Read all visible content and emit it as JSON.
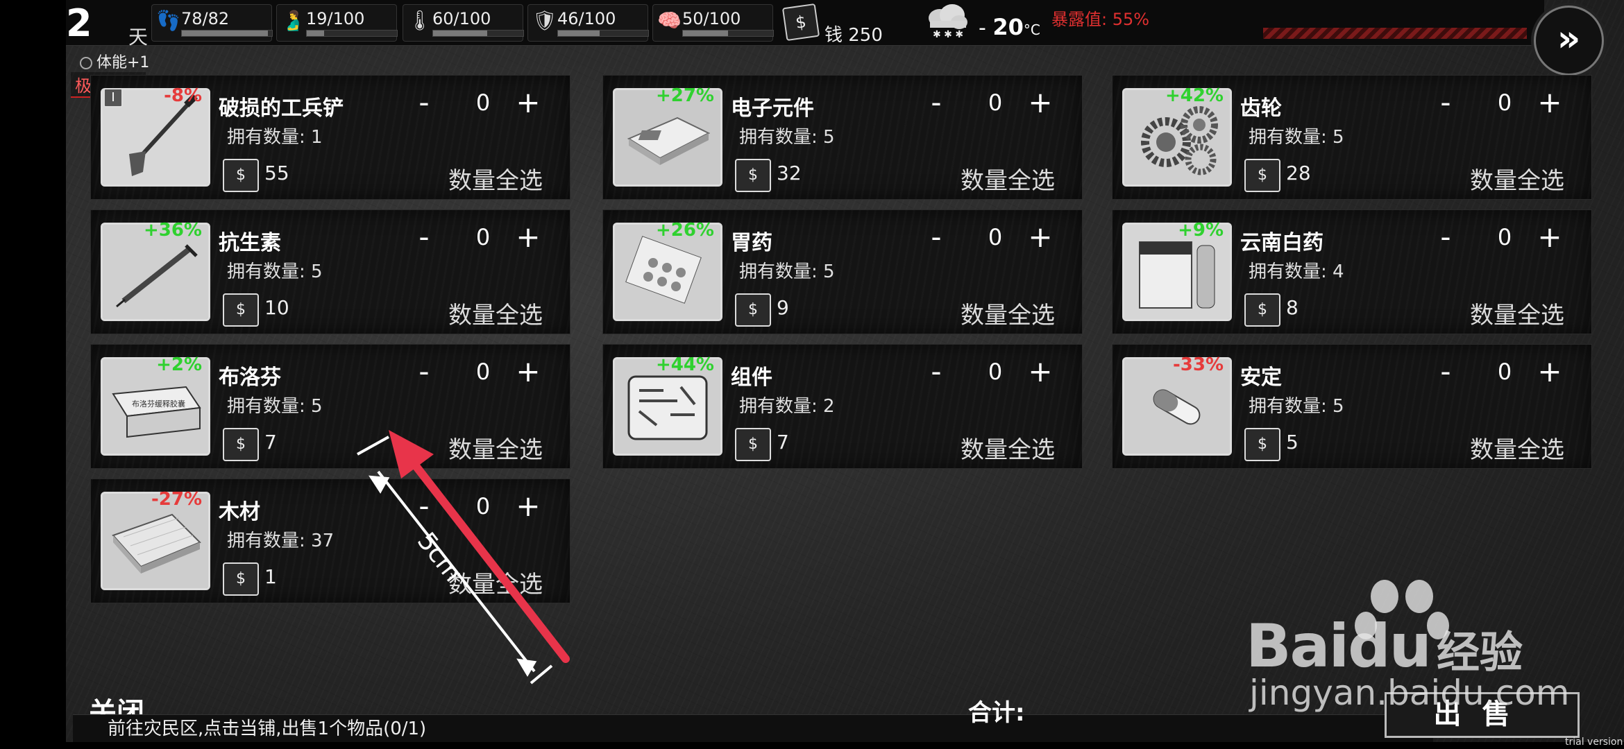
{
  "status": {
    "day": "2",
    "day_label": "天",
    "stats": [
      {
        "icon": "footprints-icon",
        "glyph": "👣",
        "value": "78/82",
        "fill": 0.95
      },
      {
        "icon": "stomach-icon",
        "glyph": "🫃",
        "value": "19/100",
        "fill": 0.19
      },
      {
        "icon": "thermometer-icon",
        "glyph": "🌡",
        "value": "60/100",
        "fill": 0.6
      },
      {
        "icon": "health-shield-icon",
        "glyph": "🛡",
        "value": "46/100",
        "fill": 0.46
      },
      {
        "icon": "mood-brain-icon",
        "glyph": "🧠",
        "value": "50/100",
        "fill": 0.5
      }
    ],
    "money_label": "钱 250",
    "temp_prefix": "- ",
    "temp_value": "20",
    "temp_unit": "°C",
    "exposure": "暴露值: 55%",
    "buff": "体能+1",
    "debuff": "极度饥饿",
    "next_glyph": "»"
  },
  "items": [
    {
      "name": "破损的工兵铲",
      "pct": "-8%",
      "sign": "neg",
      "owned": "拥有数量: 1",
      "qty": "0",
      "price": "55",
      "img": "shovel"
    },
    {
      "name": "电子元件",
      "pct": "+27%",
      "sign": "pos",
      "owned": "拥有数量: 5",
      "qty": "0",
      "price": "32",
      "img": "board"
    },
    {
      "name": "齿轮",
      "pct": "+42%",
      "sign": "pos",
      "owned": "拥有数量: 5",
      "qty": "0",
      "price": "28",
      "img": "gears"
    },
    {
      "name": "抗生素",
      "pct": "+36%",
      "sign": "pos",
      "owned": "拥有数量: 5",
      "qty": "0",
      "price": "10",
      "img": "syringe"
    },
    {
      "name": "胃药",
      "pct": "+26%",
      "sign": "pos",
      "owned": "拥有数量: 5",
      "qty": "0",
      "price": "9",
      "img": "pills"
    },
    {
      "name": "云南白药",
      "pct": "+9%",
      "sign": "pos",
      "owned": "拥有数量: 4",
      "qty": "0",
      "price": "8",
      "img": "box"
    },
    {
      "name": "布洛芬",
      "pct": "+2%",
      "sign": "pos",
      "owned": "拥有数量: 5",
      "qty": "0",
      "price": "7",
      "img": "medbox"
    },
    {
      "name": "组件",
      "pct": "+44%",
      "sign": "pos",
      "owned": "拥有数量: 2",
      "qty": "0",
      "price": "7",
      "img": "toolkit"
    },
    {
      "name": "安定",
      "pct": "-33%",
      "sign": "neg",
      "owned": "拥有数量: 5",
      "qty": "0",
      "price": "5",
      "img": "capsule"
    },
    {
      "name": "木材",
      "pct": "-27%",
      "sign": "neg",
      "owned": "拥有数量: 37",
      "qty": "0",
      "price": "1",
      "img": "wood"
    }
  ],
  "labels": {
    "minus": "-",
    "plus": "+",
    "select_all": "数量全选",
    "money_glyph": "$",
    "info_glyph": "I"
  },
  "bottom": {
    "close": "关闭",
    "quest": "前往灾民区,点击当铺,出售1个物品(0/1)",
    "total": "合计:",
    "sell": "出售",
    "trial": "trial version"
  },
  "annotation": {
    "measure": "5cm",
    "arrow_color": "#e8344a"
  },
  "watermark": {
    "brand": "Bai",
    "brand2": "du",
    "cn": "经验",
    "url": "jingyan.baidu.com"
  }
}
